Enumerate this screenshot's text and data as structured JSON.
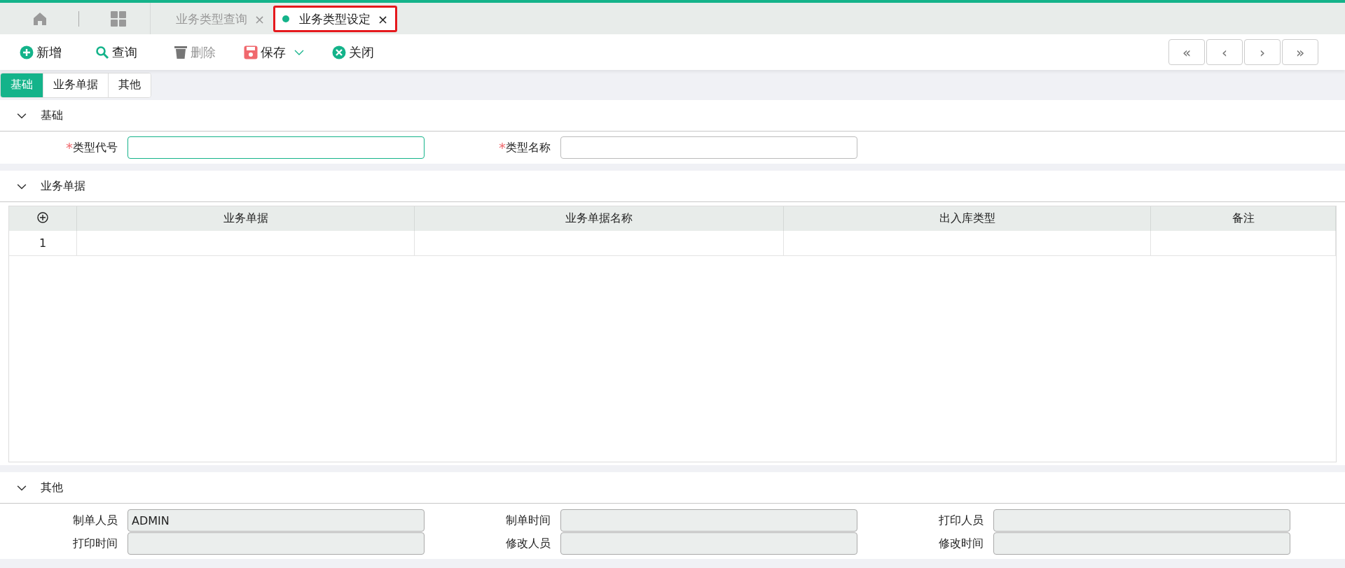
{
  "page_tabs": [
    {
      "label": "业务类型查询",
      "selected": false,
      "close": "×"
    },
    {
      "label": "业务类型设定",
      "selected": true,
      "close": "×"
    }
  ],
  "toolbar": [
    {
      "label": "新增",
      "kind": "add",
      "disabled": false,
      "dropdown": false
    },
    {
      "label": "查询",
      "kind": "query",
      "disabled": false,
      "dropdown": false
    },
    {
      "label": "删除",
      "kind": "delete",
      "disabled": true,
      "dropdown": false
    },
    {
      "label": "保存",
      "kind": "save",
      "disabled": false,
      "dropdown": true
    },
    {
      "label": "关闭",
      "kind": "close",
      "disabled": false,
      "dropdown": false
    }
  ],
  "record_nav": [
    "«",
    "‹",
    "›",
    "»"
  ],
  "form_tabs": [
    {
      "label": "基础",
      "selected": true
    },
    {
      "label": "业务单据",
      "selected": false
    },
    {
      "label": "其他",
      "selected": false
    }
  ],
  "basic": {
    "title": "基础",
    "expanded": true,
    "fields": [
      {
        "label": "类型代号",
        "required_mark": "*",
        "focused": true
      },
      {
        "label": "类型名称",
        "required_mark": "*",
        "focused": false
      }
    ]
  },
  "documents": {
    "title": "业务单据",
    "expanded": true,
    "table": {
      "columns": [
        "业务单据",
        "业务单据名称",
        "出入库类型",
        "备注"
      ],
      "rows": [
        {
          "number": "1"
        }
      ]
    }
  },
  "other": {
    "title": "其他",
    "expanded": true,
    "fields": [
      {
        "label": "制单人员",
        "value": "ADMIN",
        "disabled": true
      },
      {
        "label": "制单时间",
        "disabled": true
      },
      {
        "label": "打印人员",
        "disabled": true
      },
      {
        "label": "打印时间",
        "disabled": true
      },
      {
        "label": "修改人员",
        "disabled": true
      },
      {
        "label": "修改时间",
        "disabled": true
      }
    ]
  }
}
